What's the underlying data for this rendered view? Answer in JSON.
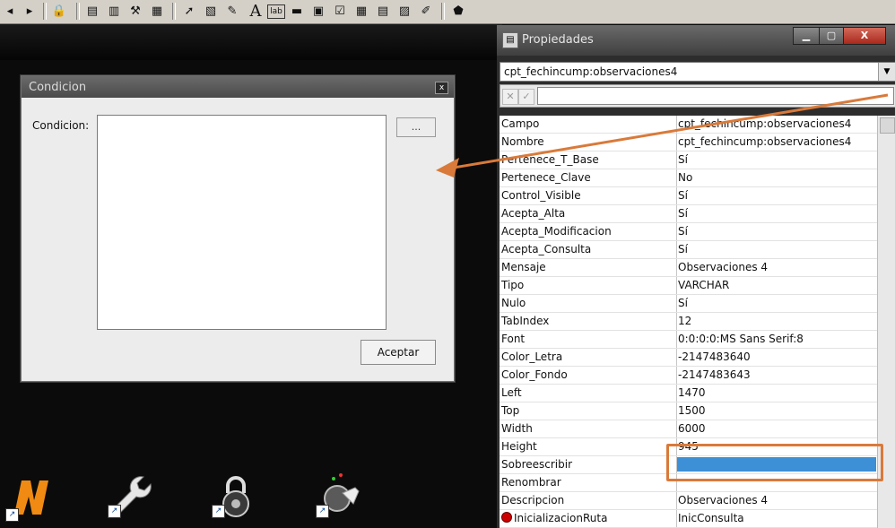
{
  "toolbar": {
    "icons": [
      "nav-prev-icon",
      "nav-next-icon",
      "lock-icon",
      "form-icon",
      "chart-icon",
      "hammer-icon",
      "grid-icon",
      "pointer-icon",
      "edit-form-icon",
      "pen-icon",
      "text-icon",
      "label-icon",
      "field-icon",
      "field-edit-icon",
      "checkbox-icon",
      "table-icon",
      "list-icon",
      "image-icon",
      "attachment-icon",
      "shield-icon"
    ],
    "text_tool": "A",
    "label_tool": "lab"
  },
  "dialog": {
    "title": "Condicion",
    "field_label": "Condicion:",
    "field_value": "",
    "ellipsis_label": "...",
    "accept_label": "Aceptar",
    "close_glyph": "x"
  },
  "properties": {
    "title": "Propiedades",
    "selected_object": "cpt_fechincump:observaciones4",
    "edit_value": "",
    "rows": [
      {
        "name": "Campo",
        "value": "cpt_fechincump:observaciones4"
      },
      {
        "name": "Nombre",
        "value": "cpt_fechincump:observaciones4"
      },
      {
        "name": "Pertenece_T_Base",
        "value": "Sí"
      },
      {
        "name": "Pertenece_Clave",
        "value": "No"
      },
      {
        "name": "Control_Visible",
        "value": "Sí"
      },
      {
        "name": "Acepta_Alta",
        "value": "Sí"
      },
      {
        "name": "Acepta_Modificacion",
        "value": "Sí"
      },
      {
        "name": "Acepta_Consulta",
        "value": "Sí"
      },
      {
        "name": "Mensaje",
        "value": "Observaciones 4"
      },
      {
        "name": "Tipo",
        "value": "VARCHAR"
      },
      {
        "name": "Nulo",
        "value": "Sí"
      },
      {
        "name": "TabIndex",
        "value": "12"
      },
      {
        "name": "Font",
        "value": "0:0:0:0:MS Sans Serif:8"
      },
      {
        "name": "Color_Letra",
        "value": "-2147483640"
      },
      {
        "name": "Color_Fondo",
        "value": "-2147483643"
      },
      {
        "name": "Left",
        "value": "1470"
      },
      {
        "name": "Top",
        "value": "1500"
      },
      {
        "name": "Width",
        "value": "6000"
      },
      {
        "name": "Height",
        "value": "945"
      },
      {
        "name": "Sobreescribir",
        "value": ""
      },
      {
        "name": "Renombrar",
        "value": ""
      },
      {
        "name": "Descripcion",
        "value": "Observaciones 4"
      },
      {
        "name": "InicializacionRuta",
        "value": "InicConsulta"
      }
    ]
  },
  "colors": {
    "annotation": "#d97a3a",
    "selection": "#3d8fd6"
  }
}
